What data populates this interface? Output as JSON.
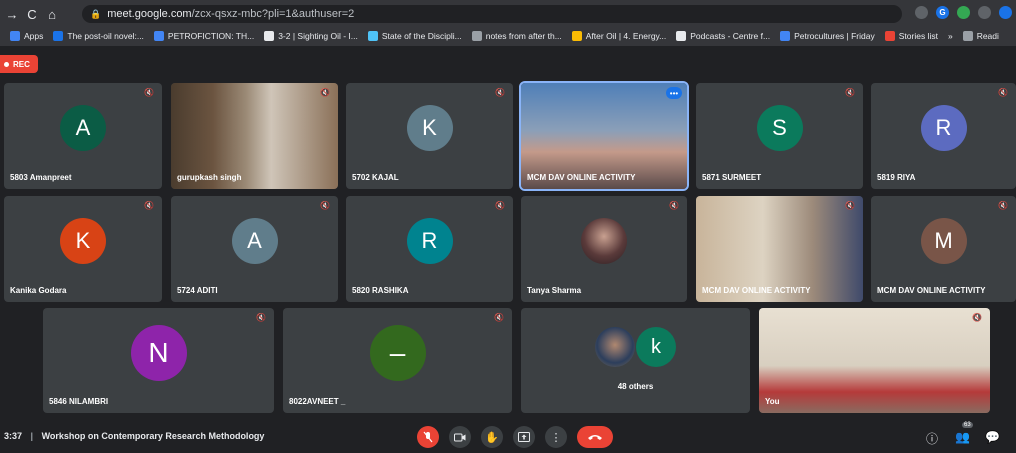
{
  "browser": {
    "nav": [
      "→",
      "C",
      "⌂"
    ],
    "url_host": "meet.google.com",
    "url_path": "/zcx-qsxz-mbc?pli=1&authuser=2",
    "bookmarks": [
      {
        "label": "Apps",
        "color": "#4285f4"
      },
      {
        "label": "The post-oil novel:...",
        "color": "#1a73e8"
      },
      {
        "label": "PETROFICTION: TH...",
        "color": "#4285f4"
      },
      {
        "label": "3-2 | Sighting Oil - I...",
        "color": "#e8eaed"
      },
      {
        "label": "State of the Discipli...",
        "color": "#4fc3f7"
      },
      {
        "label": "notes from after th...",
        "color": "#9aa0a6"
      },
      {
        "label": "After Oil | 4. Energy...",
        "color": "#fbbc04"
      },
      {
        "label": "Podcasts - Centre f...",
        "color": "#e8eaed"
      },
      {
        "label": "Petrocultures | Friday",
        "color": "#4285f4"
      },
      {
        "label": "Stories list",
        "color": "#ea4335"
      },
      {
        "label": "»",
        "color": ""
      },
      {
        "label": "Readi",
        "color": "#9aa0a6"
      }
    ]
  },
  "rec_label": "REC",
  "tiles": [
    {
      "name": "5803 Amanpreet",
      "letter": "A",
      "color": "#0b5c45"
    },
    {
      "name": "gurupkash singh",
      "letter": "",
      "color": ""
    },
    {
      "name": "5702 KAJAL",
      "letter": "K",
      "color": "#607d8b"
    },
    {
      "name": "MCM DAV ONLINE ACTIVITY",
      "letter": "",
      "color": ""
    },
    {
      "name": "5871 SURMEET",
      "letter": "S",
      "color": "#0b7a5c"
    },
    {
      "name": "5819 RIYA",
      "letter": "R",
      "color": "#5c6bc0"
    },
    {
      "name": "Kanika Godara",
      "letter": "K",
      "color": "#d84315"
    },
    {
      "name": "5724 ADITI",
      "letter": "A",
      "color": "#607d8b"
    },
    {
      "name": "5820 RASHIKA",
      "letter": "R",
      "color": "#00838f"
    },
    {
      "name": "Tanya Sharma",
      "letter": "",
      "color": ""
    },
    {
      "name": "MCM DAV ONLINE ACTIVITY",
      "letter": "",
      "color": ""
    },
    {
      "name": "MCM DAV ONLINE ACTIVITY",
      "letter": "M",
      "color": "#795548"
    },
    {
      "name": "5846 NILAMBRI",
      "letter": "N",
      "color": "#8e24aa"
    },
    {
      "name": "8022AVNEET _",
      "letter": "–",
      "color": "#33691e"
    },
    {
      "name": "48 others",
      "letter": "k",
      "color": "#0b7a5c"
    },
    {
      "name": "You",
      "letter": "",
      "color": ""
    }
  ],
  "bottom": {
    "time": "3:37",
    "separator": "|",
    "meeting_title": "Workshop on Contemporary Research Methodology",
    "people_count": "63"
  }
}
